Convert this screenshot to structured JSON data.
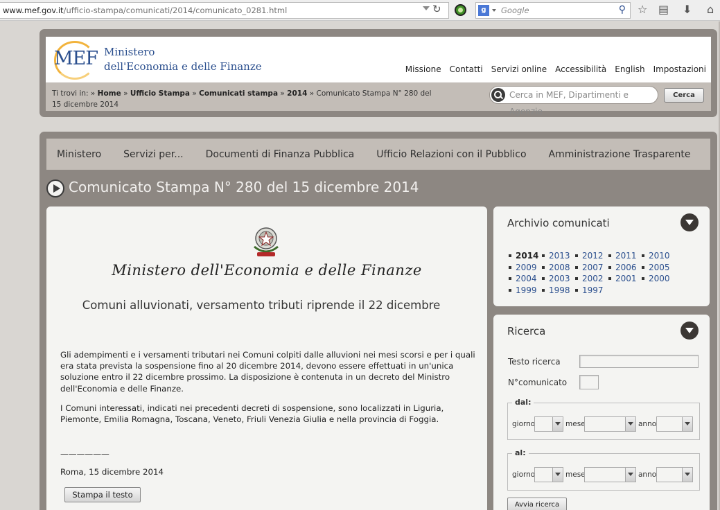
{
  "browser": {
    "url_domain": "www.mef.gov.it",
    "url_path": "/ufficio-stampa/comunicati/2014/comunicato_0281.html",
    "search_engine_letter": "g",
    "search_placeholder": "Google"
  },
  "header": {
    "logo_text": "MEF",
    "ministry_line1": "Ministero",
    "ministry_line2": "dell'Economia e delle Finanze",
    "top_links": [
      "Missione",
      "Contatti",
      "Servizi online",
      "Accessibilità",
      "English",
      "Impostazioni"
    ]
  },
  "breadcrumb": {
    "prefix": "Ti trovi in: »",
    "items": [
      "Home",
      "Ufficio Stampa",
      "Comunicati stampa",
      "2014"
    ],
    "current": "Comunicato Stampa N° 280 del 15 dicembre 2014",
    "separator": "»"
  },
  "site_search": {
    "placeholder": "Cerca in MEF, Dipartimenti e Agenzie",
    "button_label": "Cerca"
  },
  "nav": {
    "items": [
      "Ministero",
      "Servizi per...",
      "Documenti di Finanza Pubblica",
      "Ufficio Relazioni con il Pubblico",
      "Amministrazione Trasparente"
    ]
  },
  "page": {
    "title": "Comunicato Stampa N° 280 del 15 dicembre 2014"
  },
  "article": {
    "ministry_script": "Ministero dell'Economia e delle Finanze",
    "title": "Comuni alluvionati, versamento tributi riprende il 22 dicembre",
    "paragraphs": [
      "Gli adempimenti e i versamenti tributari nei Comuni colpiti dalle alluvioni nei mesi scorsi e per i quali era stata prevista la sospensione fino al 20 dicembre 2014, devono essere effettuati in un'unica soluzione entro il 22 dicembre prossimo. La disposizione è contenuta in un decreto del Ministro dell'Economia e delle Finanze.",
      "I Comuni interessati, indicati nei precedenti decreti di sospensione, sono localizzati in Liguria, Piemonte, Emilia Romagna, Toscana, Veneto, Friuli Venezia Giulia e nella provincia di Foggia."
    ],
    "signature_line": "——————",
    "place_date": "Roma, 15 dicembre 2014",
    "print_button": "Stampa il testo"
  },
  "archive": {
    "title": "Archivio comunicati",
    "current_year": "2014",
    "years": [
      "2014",
      "2013",
      "2012",
      "2011",
      "2010",
      "2009",
      "2008",
      "2007",
      "2006",
      "2005",
      "2004",
      "2003",
      "2002",
      "2001",
      "2000",
      "1999",
      "1998",
      "1997"
    ]
  },
  "ricerca": {
    "title": "Ricerca",
    "testo_label": "Testo ricerca",
    "testo_value": "",
    "numero_label": "N°comunicato",
    "numero_value": "",
    "dal_legend": "dal:",
    "al_legend": "al:",
    "giorno_label": "giorno",
    "mese_label": "mese",
    "anno_label": "anno",
    "button_label": "Avvia ricerca"
  }
}
